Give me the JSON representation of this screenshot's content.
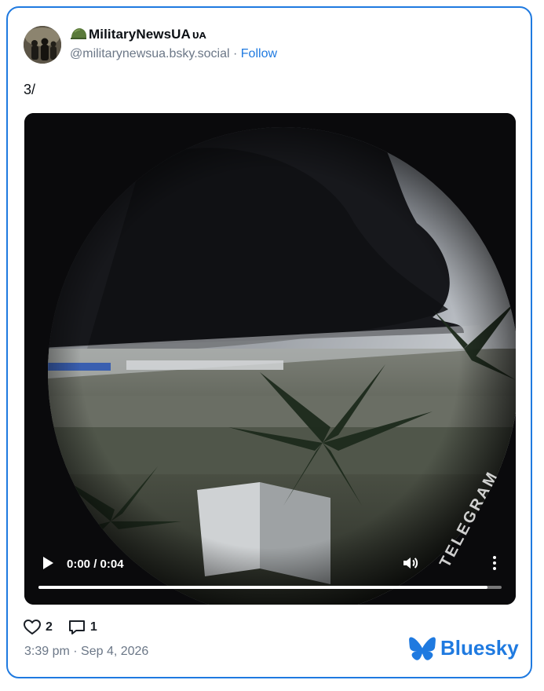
{
  "author": {
    "display_name": "MilitaryNewsUA",
    "name_suffix": "ᴜᴀ",
    "handle": "@militarynewsua.bsky.social",
    "separator": " · ",
    "follow_label": "Follow"
  },
  "post": {
    "text": "3/",
    "video": {
      "time_display": "0:00 / 0:04",
      "progress_fraction": 0.0,
      "watermark": "TELEGRAM"
    }
  },
  "engagement": {
    "likes": "2",
    "replies": "1"
  },
  "timestamp": "3:39 pm · Sep 4, 2026",
  "brand": {
    "name": "Bluesky",
    "color": "#1f7ae0"
  },
  "icons": {
    "name_emoji": "military-helmet-icon",
    "like": "heart-icon",
    "reply": "speech-bubble-icon",
    "logo": "butterfly-icon",
    "play": "play-icon",
    "volume": "volume-icon",
    "more": "more-vertical-icon"
  }
}
